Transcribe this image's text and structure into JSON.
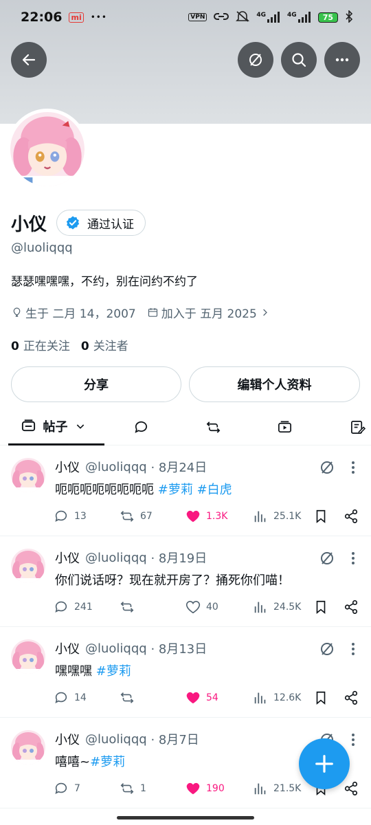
{
  "status_bar": {
    "time": "22:06",
    "mi_label": "mi",
    "dots": "•••",
    "vpn": "VPN",
    "net1": "4G",
    "net2": "4G",
    "battery": "75"
  },
  "header": {
    "back_icon": "arrow-left-icon",
    "grok_icon": "grok-slash-circle-icon",
    "search_icon": "search-icon",
    "more_icon": "more-horizontal-icon"
  },
  "profile": {
    "name": "小仪",
    "verified_label": "通过认证",
    "handle": "@luoliqqq",
    "bio": "瑟瑟嘿嘿嘿，不约，别在问约不约了",
    "birthday": "生于 二月 14，2007",
    "joined": "加入于 五月 2025",
    "following_count": "0",
    "following_label": "正在关注",
    "followers_count": "0",
    "followers_label": "关注者"
  },
  "actions": {
    "share": "分享",
    "edit_profile": "编辑个人资料"
  },
  "tabs": {
    "active_label": "帖子"
  },
  "posts": [
    {
      "name": "小仪",
      "handle": "@luoliqqq",
      "date": "· 8月24日",
      "text": "呃呃呃呃呃呃呃呃 ",
      "tags": [
        "#萝莉",
        "#白虎"
      ],
      "replies": "13",
      "reposts": "67",
      "likes": "1.3K",
      "views": "25.1K",
      "liked": true
    },
    {
      "name": "小仪",
      "handle": "@luoliqqq",
      "date": "· 8月19日",
      "text": "你们说话呀？现在就开房了？捅死你们喵！",
      "tags": [],
      "replies": "241",
      "reposts": "",
      "likes": "40",
      "views": "24.5K",
      "liked": false
    },
    {
      "name": "小仪",
      "handle": "@luoliqqq",
      "date": "· 8月13日",
      "text": "嘿嘿嘿 ",
      "tags": [
        "#萝莉"
      ],
      "replies": "14",
      "reposts": "",
      "likes": "54",
      "views": "12.6K",
      "liked": true
    },
    {
      "name": "小仪",
      "handle": "@luoliqqq",
      "date": "· 8月7日",
      "text": "嘻嘻~",
      "tags": [
        "#萝莉"
      ],
      "replies": "7",
      "reposts": "1",
      "likes": "190",
      "views": "21.5K",
      "liked": true
    }
  ],
  "colors": {
    "accent": "#1d9bf0",
    "like": "#f91880",
    "secondary_text": "#536471"
  }
}
